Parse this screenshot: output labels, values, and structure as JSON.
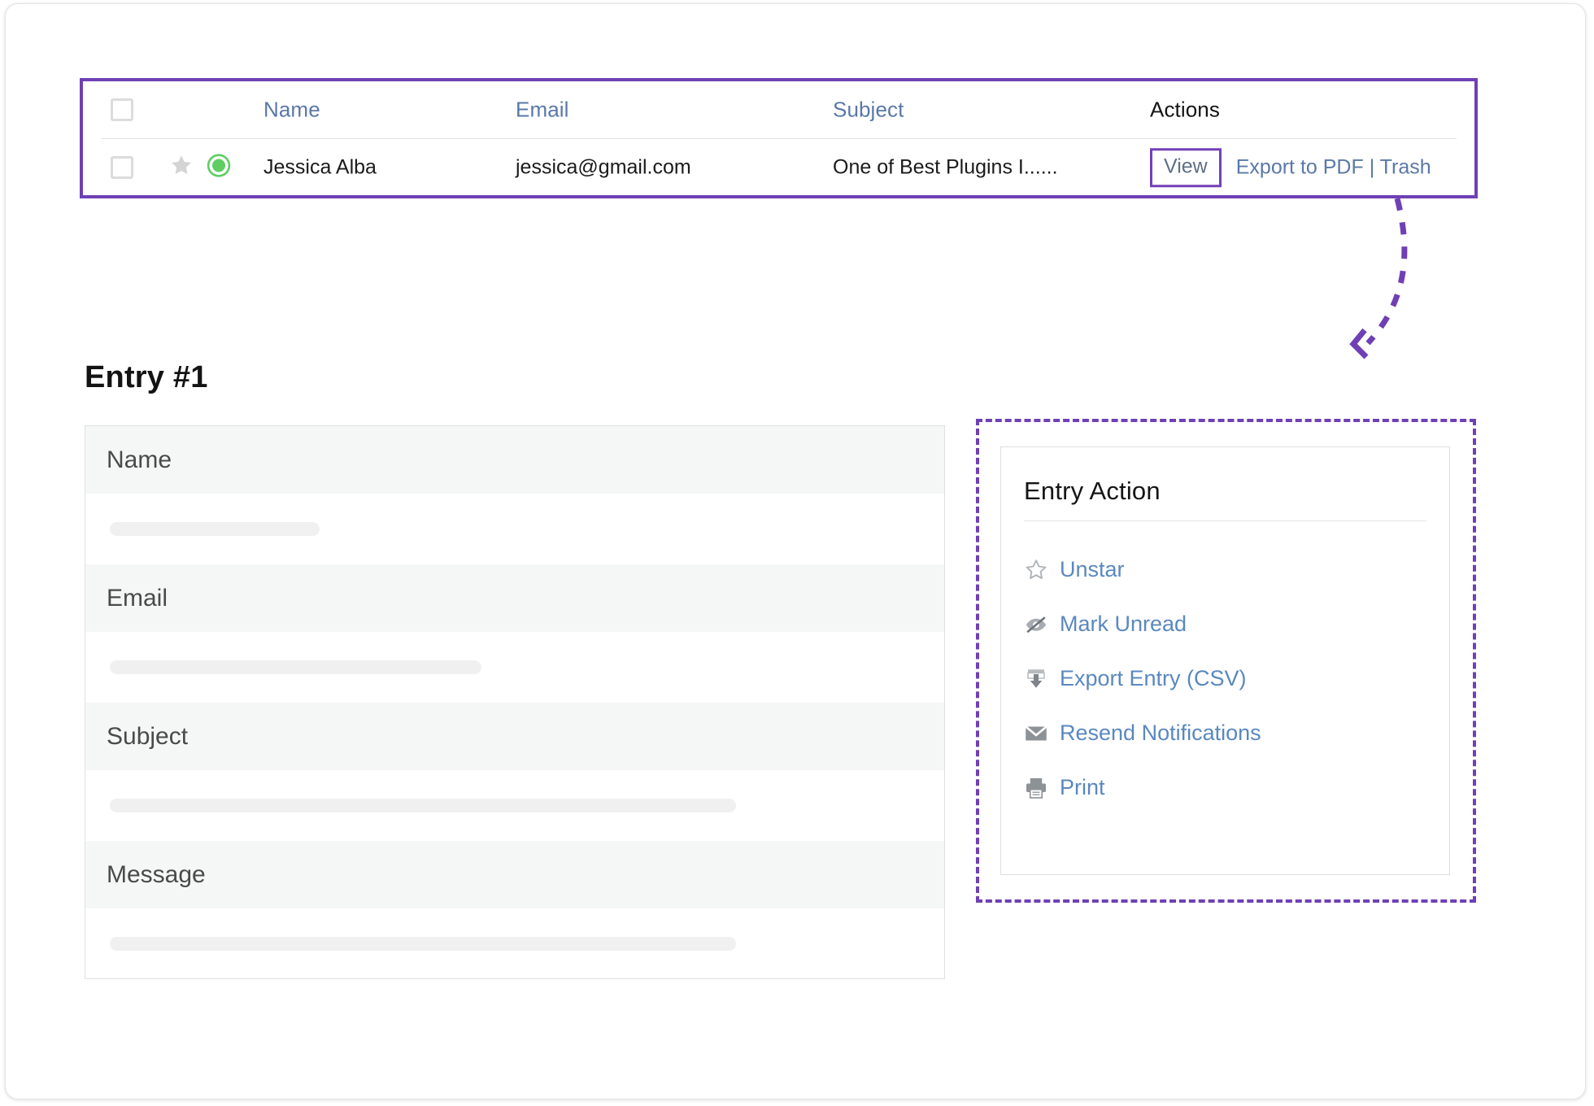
{
  "entries_table": {
    "columns": [
      {
        "key": "check",
        "label": ""
      },
      {
        "key": "name",
        "label": "Name"
      },
      {
        "key": "email",
        "label": "Email"
      },
      {
        "key": "subject",
        "label": "Subject"
      },
      {
        "key": "actions",
        "label": "Actions"
      }
    ],
    "header": {
      "name": "Name",
      "email": "Email",
      "subject": "Subject",
      "actions": "Actions"
    },
    "row": {
      "name": "Jessica Alba",
      "email": "jessica@gmail.com",
      "subject": "One of Best Plugins I......",
      "starred": true,
      "unread_indicator": "green-dot",
      "view_label": "View",
      "other_actions": "Export to PDF | Trash"
    }
  },
  "entry": {
    "title": "Entry #1",
    "fields": [
      {
        "label": "Name",
        "value": ""
      },
      {
        "label": "Email",
        "value": ""
      },
      {
        "label": "Subject",
        "value": ""
      },
      {
        "label": "Message",
        "value": ""
      }
    ]
  },
  "entry_action": {
    "title": "Entry Action",
    "items": [
      {
        "icon": "star-outline-icon",
        "label": "Unstar"
      },
      {
        "icon": "eye-slash-icon",
        "label": "Mark Unread"
      },
      {
        "icon": "download-box-icon",
        "label": "Export Entry (CSV)"
      },
      {
        "icon": "envelope-icon",
        "label": "Resend Notifications"
      },
      {
        "icon": "printer-icon",
        "label": "Print"
      }
    ]
  },
  "annotation": {
    "highlight_color": "#6f40b5",
    "arrow": "curved-dashed-arrow-from-view-to-entry-action"
  },
  "colors": {
    "highlight_purple": "#6f40b5",
    "link_blue": "#5a78a8",
    "action_link_blue": "#5a88c0",
    "status_green": "#58cc5e",
    "star_gray": "#d6d6d6",
    "row_bg": "#f5f6f6"
  }
}
